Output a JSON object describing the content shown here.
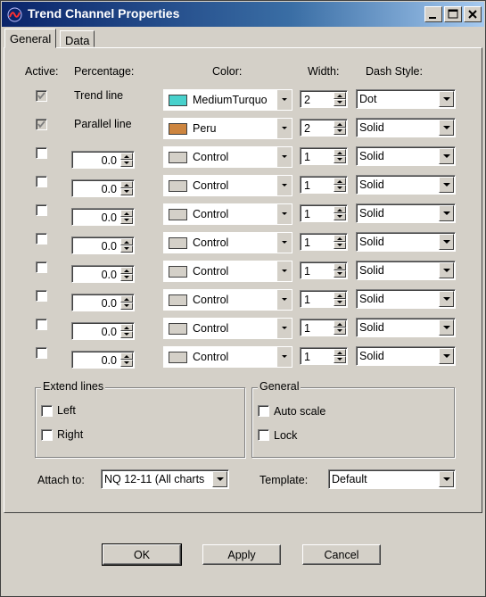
{
  "window": {
    "title": "Trend Channel Properties"
  },
  "tabs": [
    {
      "label": "General",
      "active": true
    },
    {
      "label": "Data",
      "active": false
    }
  ],
  "headers": {
    "active": "Active:",
    "percentage": "Percentage:",
    "color": "Color:",
    "width": "Width:",
    "dash_style": "Dash Style:"
  },
  "rows": [
    {
      "active": true,
      "enabled": false,
      "label": "Trend line",
      "percentage": null,
      "color_name": "MediumTurquo",
      "color_hex": "#48d1cc",
      "width": "2",
      "dash_style": "Dot"
    },
    {
      "active": true,
      "enabled": false,
      "label": "Parallel line",
      "percentage": null,
      "color_name": "Peru",
      "color_hex": "#cd853f",
      "width": "2",
      "dash_style": "Solid"
    },
    {
      "active": false,
      "enabled": true,
      "label": null,
      "percentage": "0.0",
      "color_name": "Control",
      "color_hex": "#d4d0c8",
      "width": "1",
      "dash_style": "Solid"
    },
    {
      "active": false,
      "enabled": true,
      "label": null,
      "percentage": "0.0",
      "color_name": "Control",
      "color_hex": "#d4d0c8",
      "width": "1",
      "dash_style": "Solid"
    },
    {
      "active": false,
      "enabled": true,
      "label": null,
      "percentage": "0.0",
      "color_name": "Control",
      "color_hex": "#d4d0c8",
      "width": "1",
      "dash_style": "Solid"
    },
    {
      "active": false,
      "enabled": true,
      "label": null,
      "percentage": "0.0",
      "color_name": "Control",
      "color_hex": "#d4d0c8",
      "width": "1",
      "dash_style": "Solid"
    },
    {
      "active": false,
      "enabled": true,
      "label": null,
      "percentage": "0.0",
      "color_name": "Control",
      "color_hex": "#d4d0c8",
      "width": "1",
      "dash_style": "Solid"
    },
    {
      "active": false,
      "enabled": true,
      "label": null,
      "percentage": "0.0",
      "color_name": "Control",
      "color_hex": "#d4d0c8",
      "width": "1",
      "dash_style": "Solid"
    },
    {
      "active": false,
      "enabled": true,
      "label": null,
      "percentage": "0.0",
      "color_name": "Control",
      "color_hex": "#d4d0c8",
      "width": "1",
      "dash_style": "Solid"
    },
    {
      "active": false,
      "enabled": true,
      "label": null,
      "percentage": "0.0",
      "color_name": "Control",
      "color_hex": "#d4d0c8",
      "width": "1",
      "dash_style": "Solid"
    }
  ],
  "extend_lines": {
    "title": "Extend lines",
    "left_label": "Left",
    "left_checked": false,
    "right_label": "Right",
    "right_checked": false
  },
  "general_group": {
    "title": "General",
    "auto_scale_label": "Auto scale",
    "auto_scale_checked": false,
    "lock_label": "Lock",
    "lock_checked": false
  },
  "attach_to": {
    "label": "Attach to:",
    "value": "NQ 12-11 (All charts"
  },
  "template": {
    "label": "Template:",
    "value": "Default"
  },
  "buttons": {
    "ok": "OK",
    "apply": "Apply",
    "cancel": "Cancel"
  },
  "icons": {
    "app": "trend-app-icon",
    "minimize": "minimize-icon",
    "maximize": "maximize-icon",
    "close": "close-icon"
  },
  "colors": {
    "title_bar_start": "#0a246a",
    "title_bar_end": "#a6caf0",
    "dialog_bg": "#d4d0c8"
  }
}
